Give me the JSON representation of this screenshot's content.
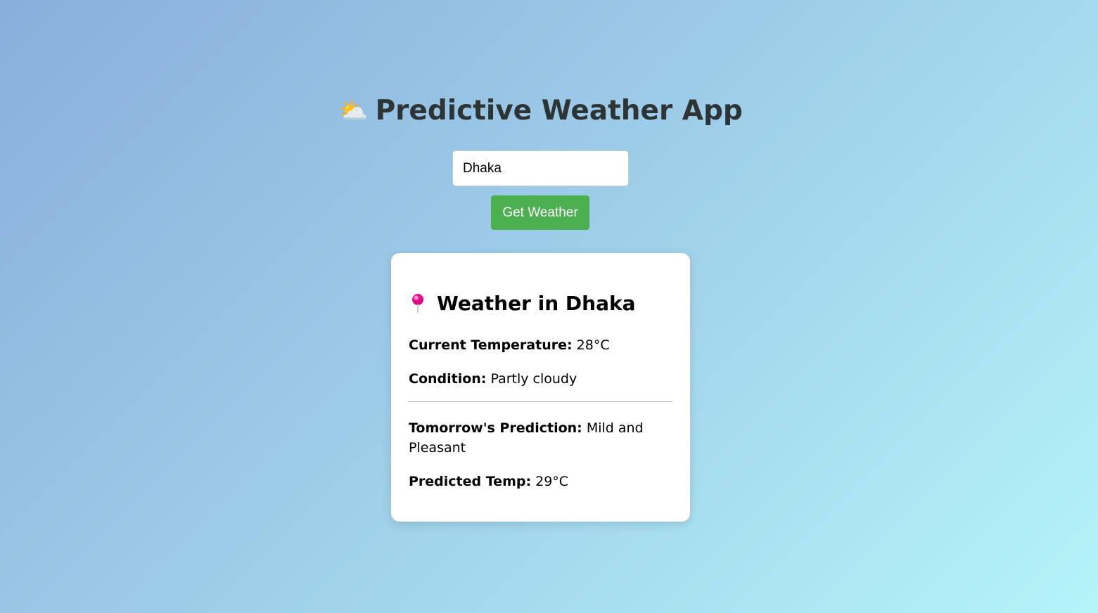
{
  "header": {
    "title": "Predictive Weather App",
    "icon": "sun-behind-cloud-icon"
  },
  "search": {
    "value": "Dhaka",
    "button_label": "Get Weather"
  },
  "result": {
    "title": "Weather in Dhaka",
    "icon": "round-pushpin-icon",
    "current_temp_label": "Current Temperature:",
    "current_temp_value": "28°C",
    "condition_label": "Condition:",
    "condition_value": "Partly cloudy",
    "prediction_label": "Tomorrow's Prediction:",
    "prediction_value": "Mild and Pleasant",
    "predicted_temp_label": "Predicted Temp:",
    "predicted_temp_value": "29°C"
  },
  "colors": {
    "button": "#4caf50",
    "title_text": "#2d3436",
    "pin": "#f0118f"
  }
}
